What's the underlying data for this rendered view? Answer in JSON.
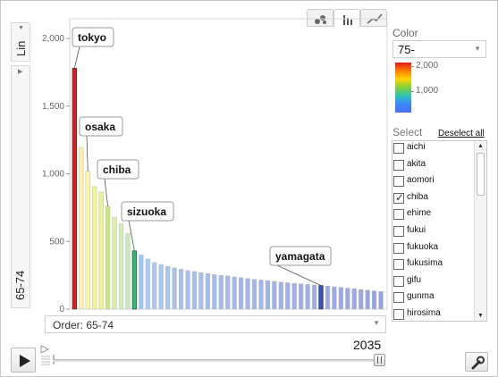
{
  "controls": {
    "y_scale": "Lin",
    "y_axis_label": "65-74",
    "order_label": "Order: 65-74",
    "time": "2035"
  },
  "color_panel": {
    "title": "Color",
    "selected": "75-",
    "scale_labels": [
      "2,000",
      "1,000"
    ]
  },
  "select_panel": {
    "title": "Select",
    "deselect_all": "Deselect all",
    "items": [
      {
        "label": "aichi",
        "checked": false
      },
      {
        "label": "akita",
        "checked": false
      },
      {
        "label": "aomori",
        "checked": false
      },
      {
        "label": "chiba",
        "checked": true
      },
      {
        "label": "ehime",
        "checked": false
      },
      {
        "label": "fukui",
        "checked": false
      },
      {
        "label": "fukuoka",
        "checked": false
      },
      {
        "label": "fukusima",
        "checked": false
      },
      {
        "label": "gifu",
        "checked": false
      },
      {
        "label": "gunma",
        "checked": false
      },
      {
        "label": "hirosima",
        "checked": false
      }
    ]
  },
  "chart_data": {
    "type": "bar",
    "yticks": [
      "2,000",
      "1,500",
      "1,000",
      "500",
      "0"
    ],
    "ylim": [
      0,
      2000
    ],
    "values": [
      1780,
      1195,
      1020,
      905,
      865,
      760,
      680,
      630,
      560,
      430,
      400,
      370,
      345,
      330,
      315,
      305,
      295,
      285,
      278,
      270,
      262,
      255,
      250,
      245,
      238,
      232,
      226,
      220,
      215,
      210,
      205,
      200,
      195,
      190,
      186,
      182,
      178,
      174,
      170,
      165,
      160,
      155,
      150,
      145,
      140,
      135,
      130
    ],
    "colors": [
      "#e31a1c",
      "#fff2b0",
      "#fff5a0",
      "#f0f590",
      "#e8f588",
      "#c8ec72",
      "#d8f0a8",
      "#d0eeb8",
      "#c6ecbe",
      "#2fb87a",
      "#9cc6f4",
      "#a8ccf5",
      "#aac8f3",
      "#a9c6f3",
      "#a8c4f2",
      "#a8c2f2",
      "#a7c0f1",
      "#a6bff1",
      "#a6bef1",
      "#a5bdf0",
      "#a5bcf0",
      "#a4bbf0",
      "#a4baef",
      "#a3b9ef",
      "#a3b8ef",
      "#a2b7ee",
      "#a2b6ee",
      "#a1b5ee",
      "#a1b4ed",
      "#a0b3ed",
      "#a0b2ed",
      "#9fb1ec",
      "#9fb0ec",
      "#9eafec",
      "#9eaeeb",
      "#9dadeb",
      "#9dacea",
      "#2f4fc2",
      "#9cabea",
      "#9caae9",
      "#9ba9e9",
      "#9ba8e9",
      "#9aa7e8",
      "#9aa6e8",
      "#99a5e8",
      "#99a4e7",
      "#98a3e7"
    ],
    "labels": [
      {
        "text": "tokyo",
        "bar": 0
      },
      {
        "text": "osaka",
        "bar": 2
      },
      {
        "text": "chiba",
        "bar": 5
      },
      {
        "text": "sizuoka",
        "bar": 9
      },
      {
        "text": "yamagata",
        "bar": 37
      }
    ]
  }
}
